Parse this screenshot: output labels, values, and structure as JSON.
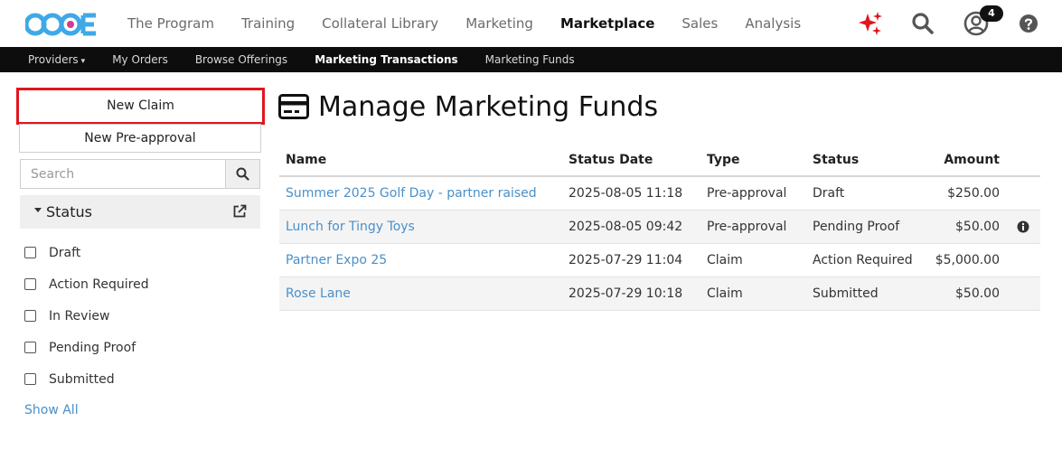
{
  "header": {
    "logo_text": "CCOE",
    "nav": [
      {
        "label": "The Program",
        "active": false
      },
      {
        "label": "Training",
        "active": false
      },
      {
        "label": "Collateral Library",
        "active": false
      },
      {
        "label": "Marketing",
        "active": false
      },
      {
        "label": "Marketplace",
        "active": true
      },
      {
        "label": "Sales",
        "active": false
      },
      {
        "label": "Analysis",
        "active": false
      }
    ],
    "icons": [
      "sparkle-icon",
      "search-icon",
      "user-icon",
      "help-icon"
    ],
    "notification_count": "4"
  },
  "subnav": {
    "items": [
      {
        "label": "Providers",
        "active": false,
        "has_dropdown": true
      },
      {
        "label": "My Orders",
        "active": false
      },
      {
        "label": "Browse Offerings",
        "active": false
      },
      {
        "label": "Marketing Transactions",
        "active": true
      },
      {
        "label": "Marketing Funds",
        "active": false
      }
    ],
    "caret": "▾"
  },
  "sidebar": {
    "new_claim_label": "New Claim",
    "new_preapproval_label": "New Pre-approval",
    "search_placeholder": "Search",
    "status_title": "Status",
    "filters": [
      {
        "label": "Draft",
        "checked": false
      },
      {
        "label": "Action Required",
        "checked": false
      },
      {
        "label": "In Review",
        "checked": false
      },
      {
        "label": "Pending Proof",
        "checked": false
      },
      {
        "label": "Submitted",
        "checked": false
      }
    ],
    "show_all_label": "Show All"
  },
  "main": {
    "title": "Manage Marketing Funds",
    "table": {
      "columns": [
        "Name",
        "Status Date",
        "Type",
        "Status",
        "Amount"
      ],
      "rows": [
        {
          "name": "Summer 2025 Golf Day - partner raised",
          "status_date": "2025-08-05 11:18",
          "type": "Pre-approval",
          "status": "Draft",
          "amount": "$250.00",
          "info": false
        },
        {
          "name": "Lunch for Tingy Toys",
          "status_date": "2025-08-05 09:42",
          "type": "Pre-approval",
          "status": "Pending Proof",
          "amount": "$50.00",
          "info": true
        },
        {
          "name": "Partner Expo 25",
          "status_date": "2025-07-29 11:04",
          "type": "Claim",
          "status": "Action Required",
          "amount": "$5,000.00",
          "info": false
        },
        {
          "name": "Rose Lane",
          "status_date": "2025-07-29 10:18",
          "type": "Claim",
          "status": "Submitted",
          "amount": "$50.00",
          "info": false
        }
      ]
    }
  },
  "colors": {
    "accent_link": "#4a90c9",
    "highlight_border": "#e0161e",
    "subnav_bg": "#0d0d0d",
    "sparkle": "#e0161e"
  }
}
